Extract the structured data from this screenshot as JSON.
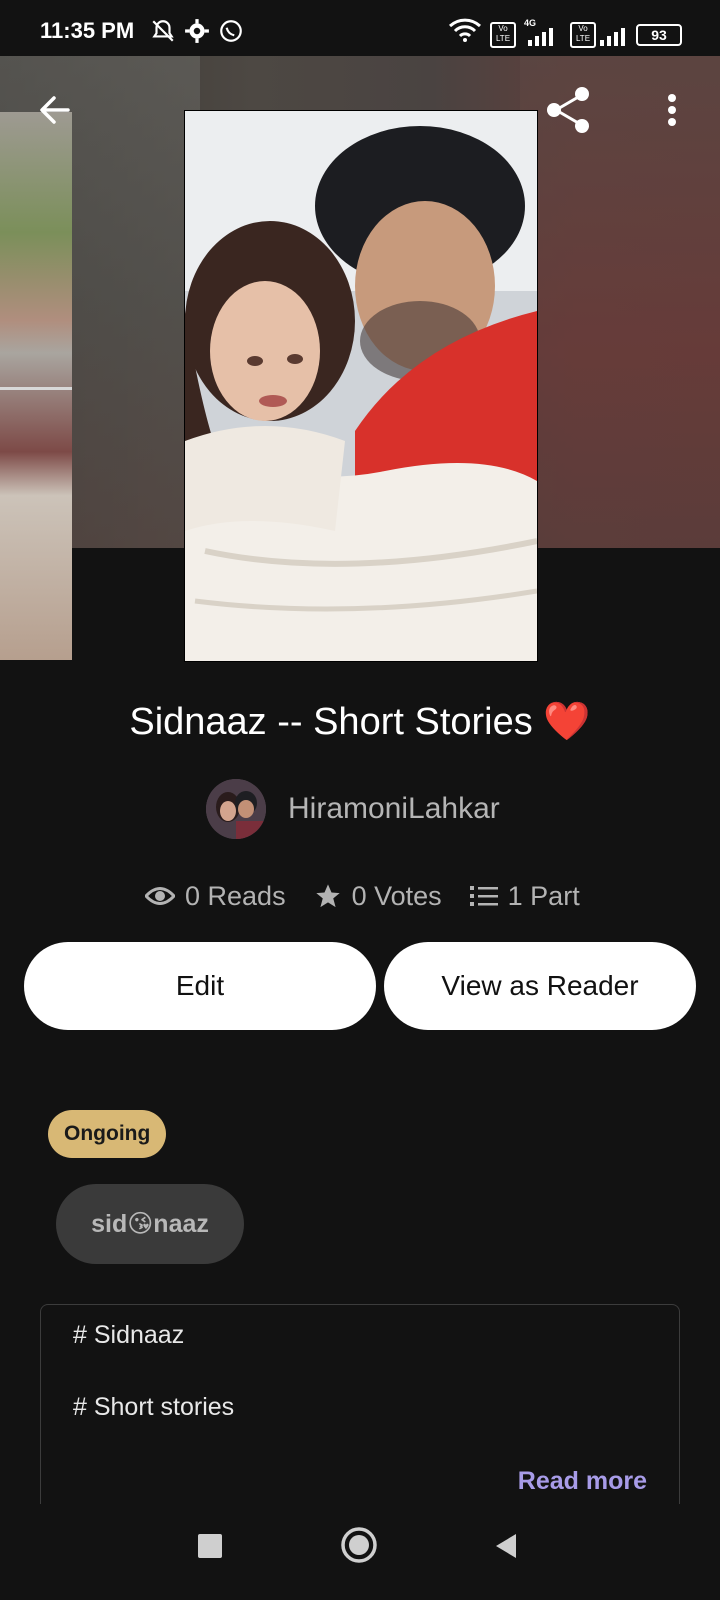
{
  "status_bar": {
    "time": "11:35 PM",
    "battery": "93",
    "network_label": "4G",
    "volte_label": "Vo LTE",
    "icons": [
      "bell-off-icon",
      "gear-icon",
      "whatsapp-icon",
      "wifi-icon",
      "volte-icon",
      "signal-icon",
      "volte-icon",
      "signal-icon",
      "battery-icon"
    ]
  },
  "toolbar": {
    "back_icon": "arrow-left-icon",
    "share_icon": "share-icon",
    "menu_icon": "more-vertical-icon"
  },
  "story": {
    "title": "Sidnaaz -- Short Stories",
    "title_emoji": "❤️",
    "author": "HiramoniLahkar",
    "stats": {
      "reads": "0 Reads",
      "votes": "0 Votes",
      "parts": "1 Part"
    },
    "status_badge": "Ongoing",
    "tag": "sid😘naaz",
    "description_lines": [
      "# Sidnaaz",
      "# Short stories"
    ],
    "read_more": "Read more"
  },
  "actions": {
    "edit_label": "Edit",
    "view_as_reader_label": "View as Reader"
  },
  "colors": {
    "background": "#121212",
    "badge": "#d8b875",
    "link": "#a89ce8",
    "heart": "#e0242a"
  }
}
